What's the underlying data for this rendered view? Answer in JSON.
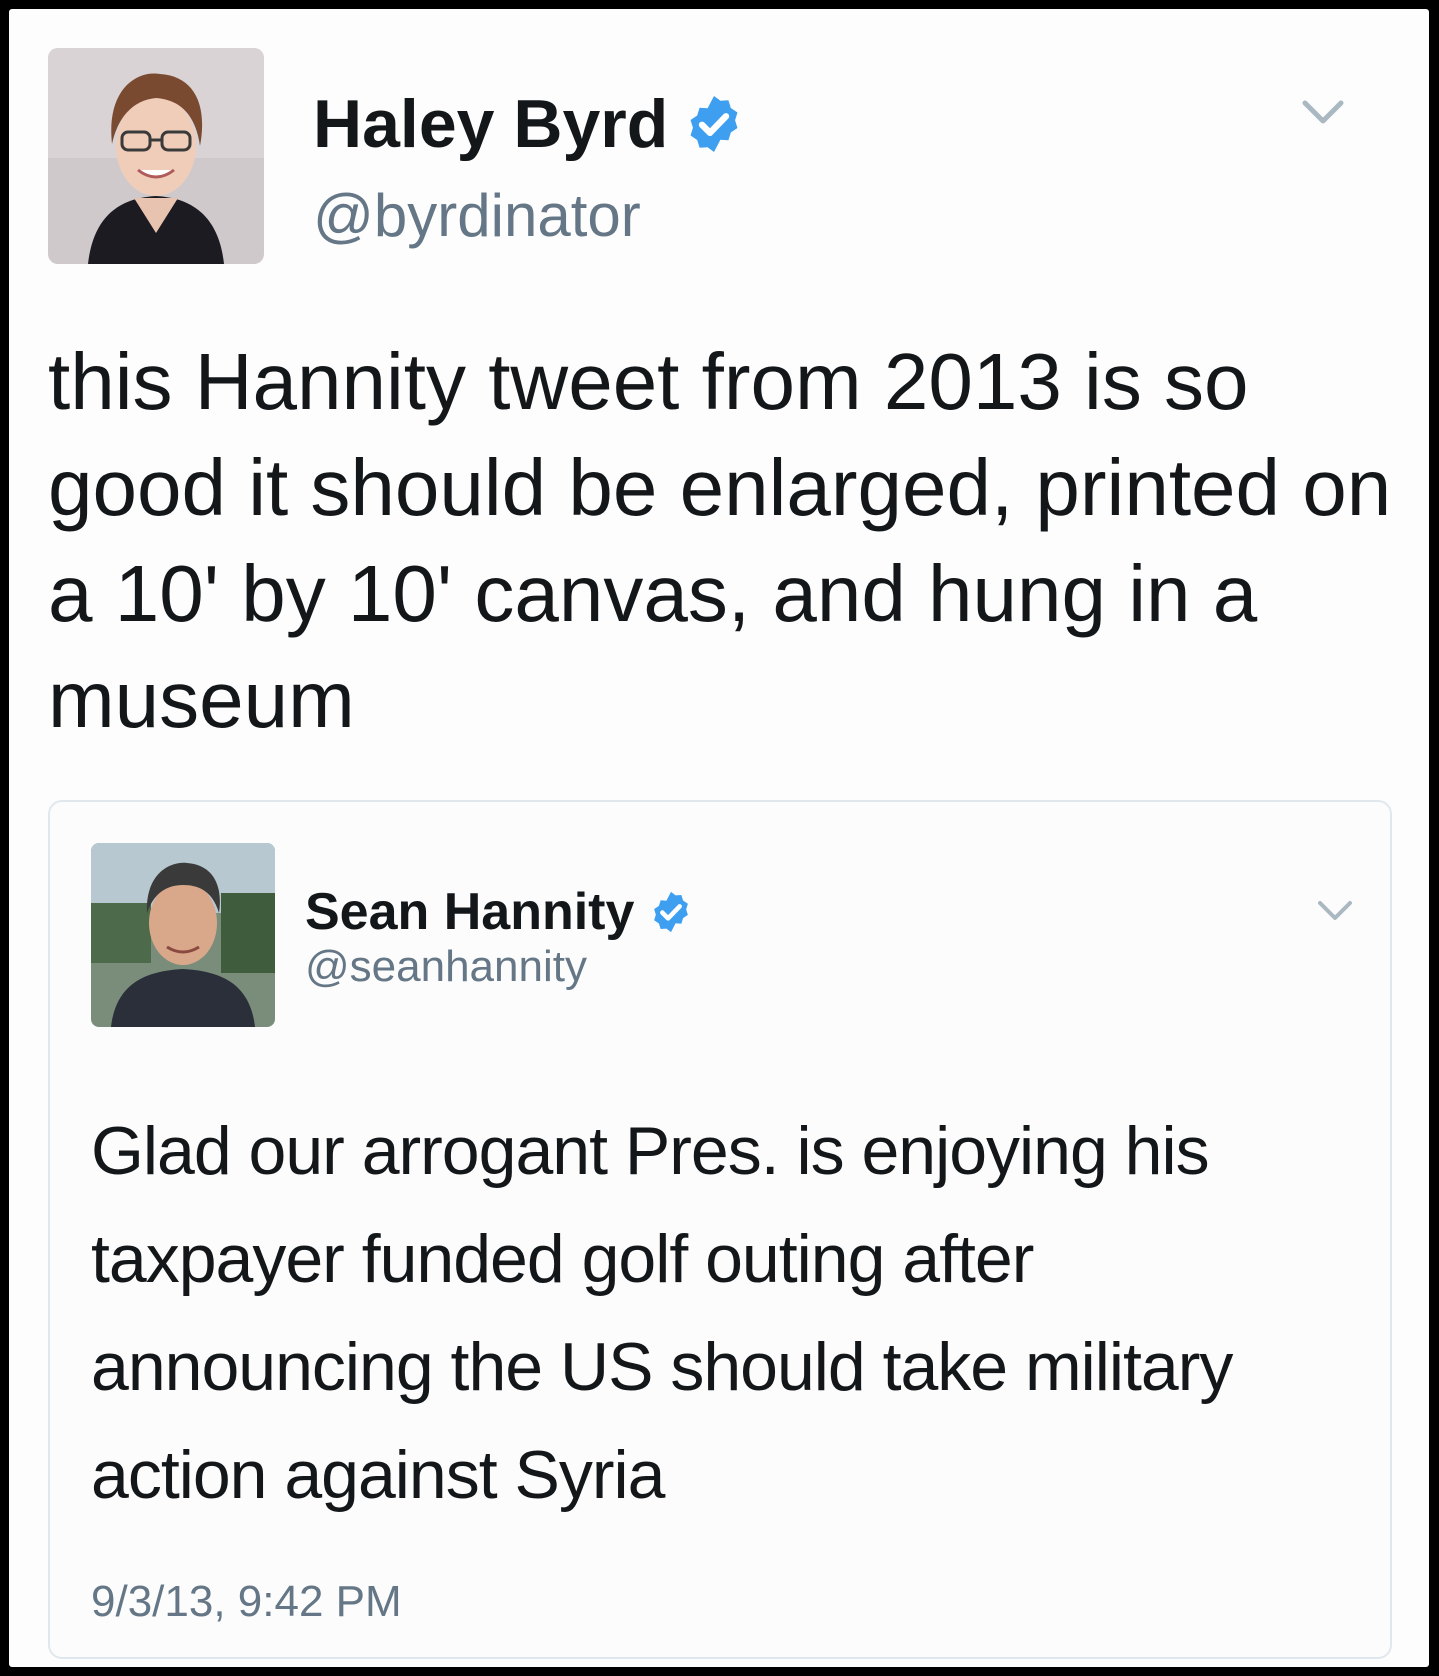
{
  "main_tweet": {
    "author_name": "Haley Byrd",
    "author_handle": "@byrdinator",
    "verified": true,
    "text": "this Hannity tweet from 2013 is so good it should be enlarged, printed on a 10' by 10' canvas, and hung in a museum",
    "menu_icon": "chevron-down-icon"
  },
  "quoted_tweet": {
    "author_name": "Sean Hannity",
    "author_handle": "@seanhannity",
    "verified": true,
    "text": "Glad our arrogant Pres. is enjoying his taxpayer funded golf outing after announcing the US should take military action against Syria",
    "timestamp": "9/3/13, 9:42 PM",
    "menu_icon": "chevron-down-icon"
  },
  "colors": {
    "verified_blue": "#3e9ff1",
    "text_primary": "#14171a",
    "text_secondary": "#657786",
    "border": "#e1e8ed"
  }
}
